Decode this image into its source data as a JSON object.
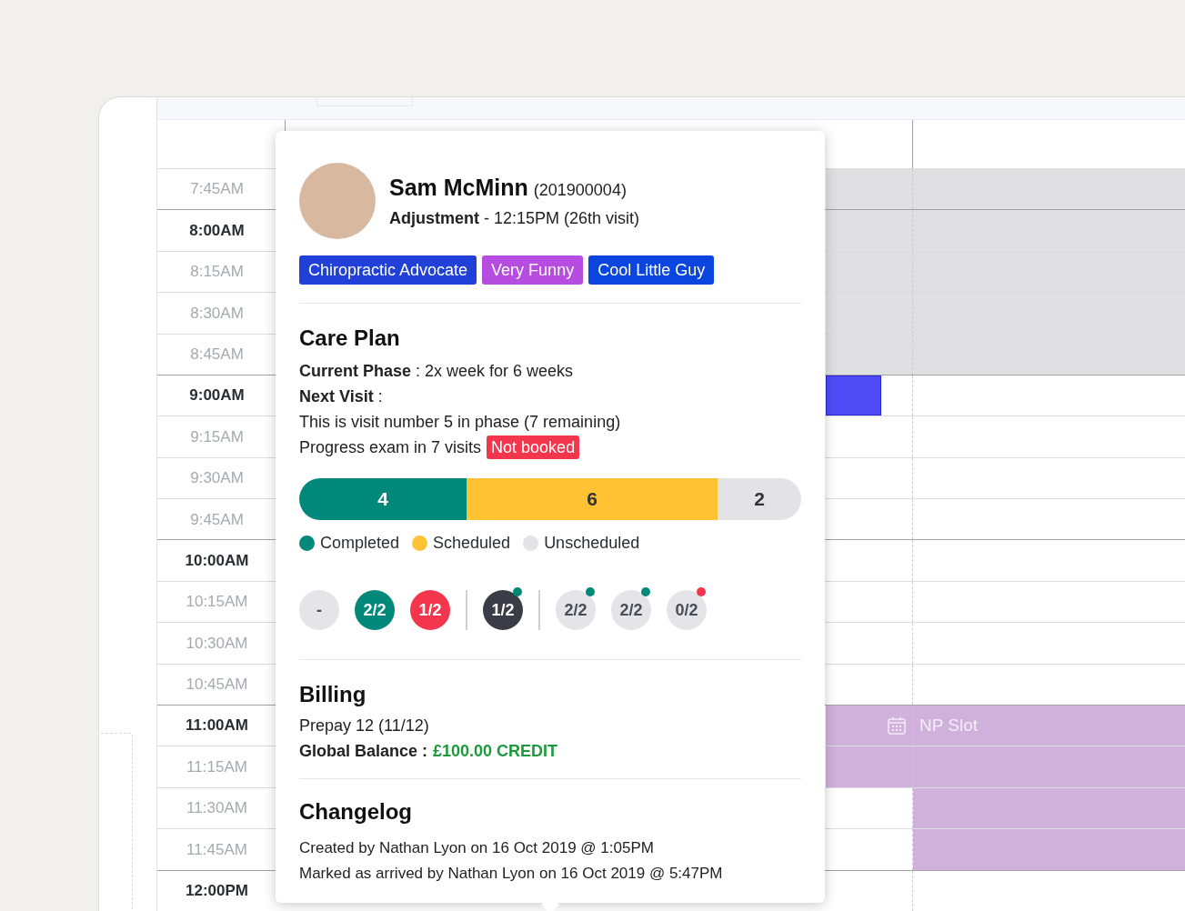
{
  "rows": [
    {
      "time": "7:45AM",
      "major": false,
      "cells": [
        {
          "kind": "unavailable"
        },
        {
          "kind": "unavailable"
        }
      ]
    },
    {
      "time": "8:00AM",
      "major": true,
      "cells": [
        {
          "kind": "unavailable"
        },
        {
          "kind": "unavailable"
        }
      ]
    },
    {
      "time": "8:15AM",
      "major": false,
      "cells": [
        {
          "kind": "unavailable"
        },
        {
          "kind": "unavailable"
        }
      ]
    },
    {
      "time": "8:30AM",
      "major": false,
      "cells": [
        {
          "kind": "unavailable"
        },
        {
          "kind": "unavailable"
        }
      ]
    },
    {
      "time": "8:45AM",
      "major": false,
      "cells": [
        {
          "kind": "unavailable"
        },
        {
          "kind": "unavailable"
        }
      ]
    },
    {
      "time": "9:00AM",
      "major": true,
      "cells": [
        {
          "kind": "appointment"
        },
        {
          "kind": "empty"
        }
      ]
    },
    {
      "time": "9:15AM",
      "major": false,
      "cells": [
        {
          "kind": "empty"
        },
        {
          "kind": "empty"
        }
      ]
    },
    {
      "time": "9:30AM",
      "major": false,
      "cells": [
        {
          "kind": "empty"
        },
        {
          "kind": "empty"
        }
      ]
    },
    {
      "time": "9:45AM",
      "major": false,
      "cells": [
        {
          "kind": "empty"
        },
        {
          "kind": "empty"
        }
      ]
    },
    {
      "time": "10:00AM",
      "major": true,
      "cells": [
        {
          "kind": "empty"
        },
        {
          "kind": "empty"
        }
      ]
    },
    {
      "time": "10:15AM",
      "major": false,
      "cells": [
        {
          "kind": "empty"
        },
        {
          "kind": "empty"
        }
      ]
    },
    {
      "time": "10:30AM",
      "major": false,
      "cells": [
        {
          "kind": "empty"
        },
        {
          "kind": "empty"
        }
      ]
    },
    {
      "time": "10:45AM",
      "major": false,
      "cells": [
        {
          "kind": "empty"
        },
        {
          "kind": "empty"
        }
      ]
    },
    {
      "time": "11:00AM",
      "major": true,
      "cells": [
        {
          "kind": "npstart"
        },
        {
          "kind": "npslot",
          "label": "NP Slot"
        }
      ]
    },
    {
      "time": "11:15AM",
      "major": false,
      "cells": [
        {
          "kind": "npslot"
        },
        {
          "kind": "npslot"
        }
      ]
    },
    {
      "time": "11:30AM",
      "major": false,
      "cells": [
        {
          "kind": "empty"
        },
        {
          "kind": "npslot"
        }
      ]
    },
    {
      "time": "11:45AM",
      "major": false,
      "cells": [
        {
          "kind": "empty"
        },
        {
          "kind": "npslot"
        }
      ]
    },
    {
      "time": "12:00PM",
      "major": true,
      "cells": [
        {
          "kind": "empty"
        },
        {
          "kind": "empty"
        }
      ]
    }
  ],
  "popup": {
    "name": "Sam McMinn",
    "patient_number": "(201900004)",
    "appointment": "**Adjustment** - 12:15PM (26th visit)",
    "tags": [
      {
        "label": "Chiropractic Advocate",
        "color": "#2040d8"
      },
      {
        "label": "Very Funny",
        "color": "#b64ce0"
      },
      {
        "label": "Cool Little Guy",
        "color": "#0b45e0"
      }
    ],
    "care_plan": {
      "title": "Care Plan",
      "lines": [
        "**Current Phase** : 2x week for 6 weeks",
        "**Next Visit** :",
        "This is visit number 5 in phase (7 remaining)"
      ],
      "progress_exam": "Progress exam in 7 visits",
      "exam_badge": "Not booked",
      "segments": [
        {
          "label": "4",
          "kind": "completed"
        },
        {
          "label": "6",
          "kind": "scheduled"
        },
        {
          "label": "2",
          "kind": "unscheduled"
        }
      ],
      "legend": [
        {
          "label": "Completed",
          "kind": "completed"
        },
        {
          "label": "Scheduled",
          "kind": "scheduled"
        },
        {
          "label": "Unscheduled",
          "kind": "unscheduled"
        }
      ],
      "visit_groups": [
        [
          {
            "label": "-",
            "kind": "empty"
          },
          {
            "label": "2/2",
            "kind": "complete"
          },
          {
            "label": "1/2",
            "kind": "missed"
          }
        ],
        [
          {
            "label": "1/2",
            "kind": "current",
            "status_dot": {
              "color": "#00897b"
            }
          }
        ],
        [
          {
            "label": "2/2",
            "kind": "empty",
            "status_dot": {
              "color": "#00897b"
            }
          },
          {
            "label": "2/2",
            "kind": "empty",
            "status_dot": {
              "color": "#00897b"
            }
          },
          {
            "label": "0/2",
            "kind": "empty",
            "status_dot": {
              "color": "#f4364c"
            }
          }
        ]
      ]
    },
    "billing": {
      "title": "Billing",
      "prepay": "Prepay 12 (11/12)",
      "balance_label": "Global Balance :",
      "balance_value": "£100.00 CREDIT"
    },
    "changelog": {
      "title": "Changelog",
      "entries": [
        "Created by Nathan Lyon on 16 Oct 2019 @ 1:05PM",
        "Marked as arrived by Nathan Lyon on 16 Oct 2019 @ 5:47PM"
      ]
    }
  }
}
